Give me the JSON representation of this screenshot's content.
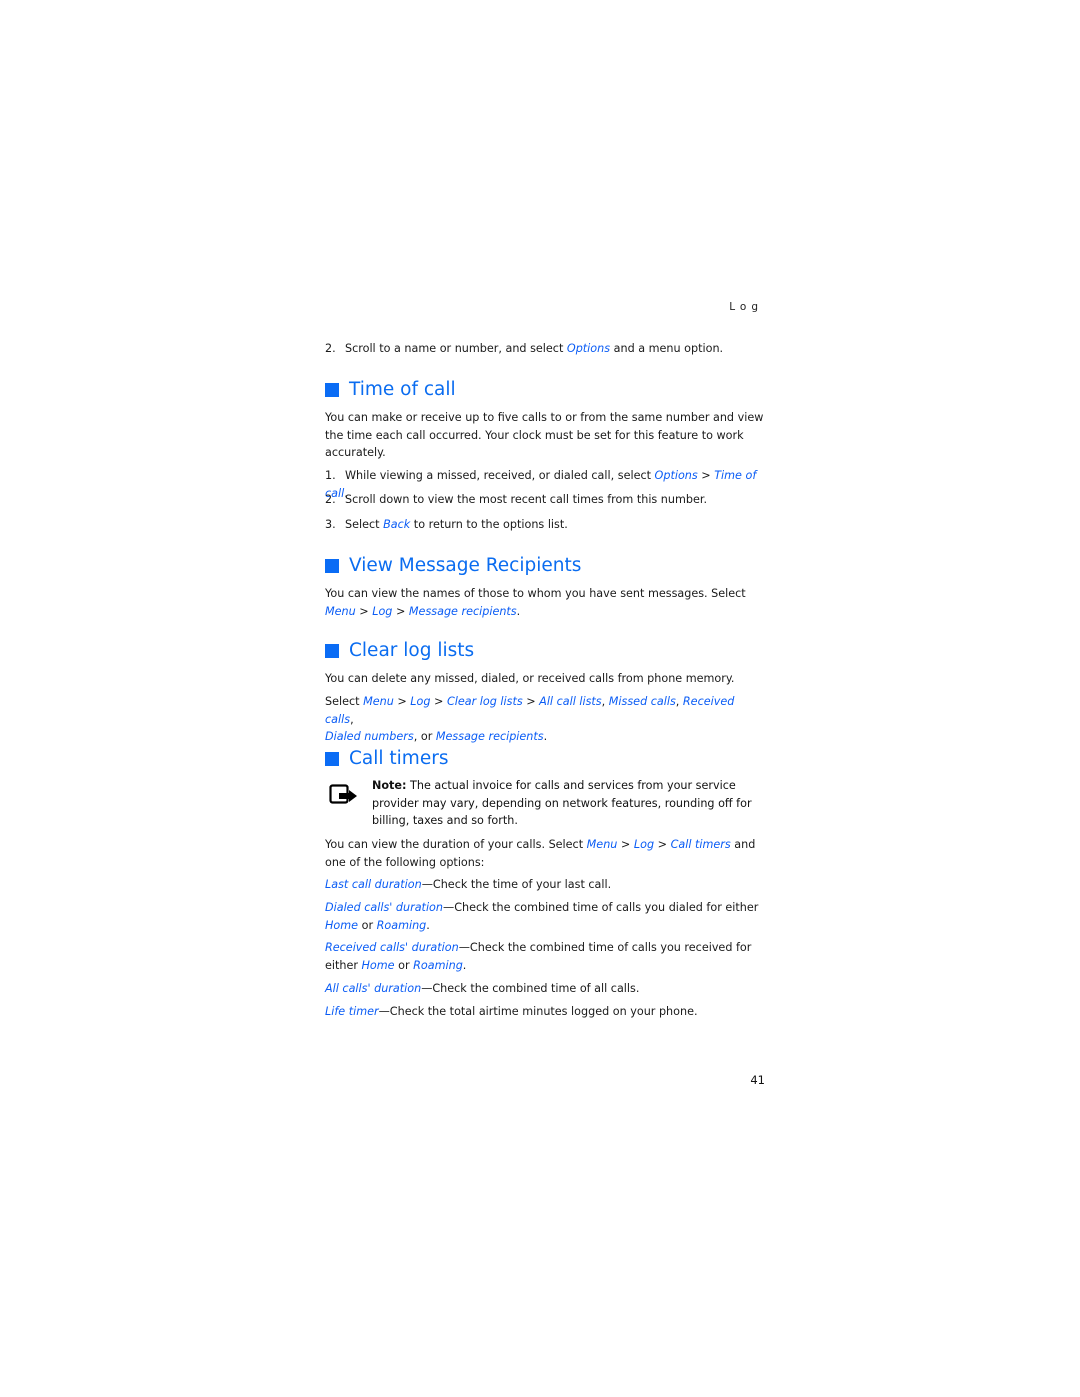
{
  "running_head": "Log",
  "intro_step": {
    "num": "2.",
    "pre": "Scroll to a name or number, and select ",
    "link": "Options",
    "post": " and a menu option."
  },
  "time_of_call": {
    "title": "Time of call",
    "body": "You can make or receive up to five calls to or from the same number and view the time each call occurred. Your clock must be set for this feature to work accurately.",
    "steps": [
      {
        "num": "1.",
        "pre": "While viewing a missed, received, or dialed call, select ",
        "link1": "Options",
        "sep": " > ",
        "link2": "Time of call",
        "post": "."
      },
      {
        "num": "2.",
        "text": "Scroll down to view the most recent call times from this number."
      },
      {
        "num": "3.",
        "pre": "Select ",
        "link": "Back",
        "post": " to return to the options list."
      }
    ]
  },
  "view_recipients": {
    "title": "View Message Recipients",
    "body": "You can view the names of those to whom you have sent messages. Select",
    "path": [
      "Menu",
      "Log",
      "Message recipients"
    ]
  },
  "clear_log": {
    "title": "Clear log lists",
    "body": "You can delete any missed, dialed, or received calls from phone memory.",
    "select": "Select",
    "path": [
      "Menu",
      "Log",
      "Clear log lists"
    ],
    "options": [
      "All call lists",
      "Missed calls",
      "Received calls",
      "Dialed numbers",
      "Message recipients"
    ],
    "or": "or"
  },
  "call_timers": {
    "title": "Call timers",
    "note_label": "Note:",
    "note_text": " The actual invoice for calls and services from your service provider may vary, depending on network features, rounding off for billing, taxes and so forth.",
    "body_pre": "You can view the duration of your calls. Select ",
    "path": [
      "Menu",
      "Log",
      "Call timers"
    ],
    "body_post": " and one of the following options:",
    "options": [
      {
        "name": "Last call duration",
        "desc": "—Check the time of your last call."
      },
      {
        "name": "Dialed calls' duration",
        "desc": "—Check the combined time of calls you dialed for either ",
        "a": "Home",
        "or": " or ",
        "b": "Roaming"
      },
      {
        "name": "Received calls' duration",
        "desc": "—Check the combined time of calls you received for either ",
        "a": "Home",
        "or": " or ",
        "b": "Roaming"
      },
      {
        "name": "All calls' duration",
        "desc": "—Check the combined time of all calls."
      },
      {
        "name": "Life timer",
        "desc": "—Check the total airtime minutes logged on your phone."
      }
    ]
  },
  "page_number": "41",
  "colors": {
    "accent": "#0a6cf5",
    "link": "#0a5cf5"
  }
}
